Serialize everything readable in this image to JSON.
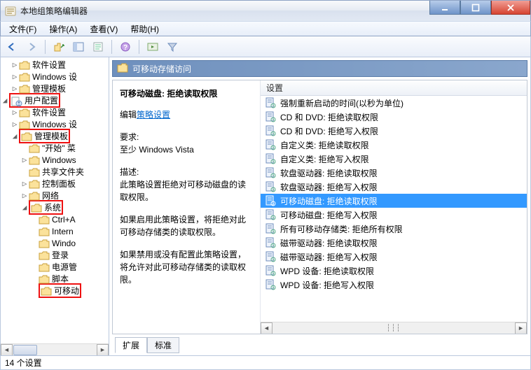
{
  "window": {
    "title": "本地组策略编辑器"
  },
  "menu": {
    "file": "文件(F)",
    "action": "操作(A)",
    "view": "查看(V)",
    "help": "帮助(H)"
  },
  "tree": {
    "items": [
      {
        "label": "软件设置",
        "indent": 1,
        "exp": "▷",
        "hl": false
      },
      {
        "label": "Windows 设",
        "indent": 1,
        "exp": "▷",
        "hl": false
      },
      {
        "label": "管理模板",
        "indent": 1,
        "exp": "▷",
        "hl": false
      },
      {
        "label": "用户配置",
        "indent": 0,
        "exp": "◢",
        "hl": true,
        "special": "user"
      },
      {
        "label": "软件设置",
        "indent": 1,
        "exp": "▷",
        "hl": false
      },
      {
        "label": "Windows 设",
        "indent": 1,
        "exp": "▷",
        "hl": false
      },
      {
        "label": "管理模板",
        "indent": 1,
        "exp": "◢",
        "hl": true
      },
      {
        "label": "\"开始\" 菜",
        "indent": 2,
        "exp": " ",
        "hl": false
      },
      {
        "label": "Windows",
        "indent": 2,
        "exp": "▷",
        "hl": false
      },
      {
        "label": "共享文件夹",
        "indent": 2,
        "exp": " ",
        "hl": false
      },
      {
        "label": "控制面板",
        "indent": 2,
        "exp": "▷",
        "hl": false
      },
      {
        "label": "网络",
        "indent": 2,
        "exp": "▷",
        "hl": false
      },
      {
        "label": "系统",
        "indent": 2,
        "exp": "◢",
        "hl": true
      },
      {
        "label": "Ctrl+A",
        "indent": 3,
        "exp": " ",
        "hl": false
      },
      {
        "label": "Intern",
        "indent": 3,
        "exp": " ",
        "hl": false
      },
      {
        "label": "Windo",
        "indent": 3,
        "exp": " ",
        "hl": false
      },
      {
        "label": "登录",
        "indent": 3,
        "exp": " ",
        "hl": false
      },
      {
        "label": "电源管",
        "indent": 3,
        "exp": " ",
        "hl": false
      },
      {
        "label": "脚本",
        "indent": 3,
        "exp": " ",
        "hl": false
      },
      {
        "label": "可移动",
        "indent": 3,
        "exp": " ",
        "hl": true
      }
    ]
  },
  "header": {
    "title": "可移动存储访问"
  },
  "detail": {
    "title": "可移动磁盘: 拒绝读取权限",
    "edit_prefix": "编辑",
    "edit_link": "策略设置",
    "req_label": "要求:",
    "req_value": "至少 Windows Vista",
    "desc_label": "描述:",
    "desc_text": "此策略设置拒绝对可移动磁盘的读取权限。",
    "enable_text": "如果启用此策略设置，将拒绝对此可移动存储类的读取权限。",
    "disable_text": "如果禁用或没有配置此策略设置，将允许对此可移动存储类的读取权限。"
  },
  "listhdr": {
    "col": "设置"
  },
  "list": {
    "rows": [
      {
        "label": "强制重新启动的时间(以秒为单位)",
        "sel": false
      },
      {
        "label": "CD 和 DVD: 拒绝读取权限",
        "sel": false
      },
      {
        "label": "CD 和 DVD: 拒绝写入权限",
        "sel": false
      },
      {
        "label": "自定义类: 拒绝读取权限",
        "sel": false
      },
      {
        "label": "自定义类: 拒绝写入权限",
        "sel": false
      },
      {
        "label": "软盘驱动器: 拒绝读取权限",
        "sel": false
      },
      {
        "label": "软盘驱动器: 拒绝写入权限",
        "sel": false
      },
      {
        "label": "可移动磁盘: 拒绝读取权限",
        "sel": true
      },
      {
        "label": "可移动磁盘: 拒绝写入权限",
        "sel": false
      },
      {
        "label": "所有可移动存储类: 拒绝所有权限",
        "sel": false
      },
      {
        "label": "磁带驱动器: 拒绝读取权限",
        "sel": false
      },
      {
        "label": "磁带驱动器: 拒绝写入权限",
        "sel": false
      },
      {
        "label": "WPD 设备: 拒绝读取权限",
        "sel": false
      },
      {
        "label": "WPD 设备: 拒绝写入权限",
        "sel": false
      }
    ]
  },
  "tabs": {
    "extended": "扩展",
    "standard": "标准"
  },
  "status": {
    "text": "14 个设置"
  }
}
